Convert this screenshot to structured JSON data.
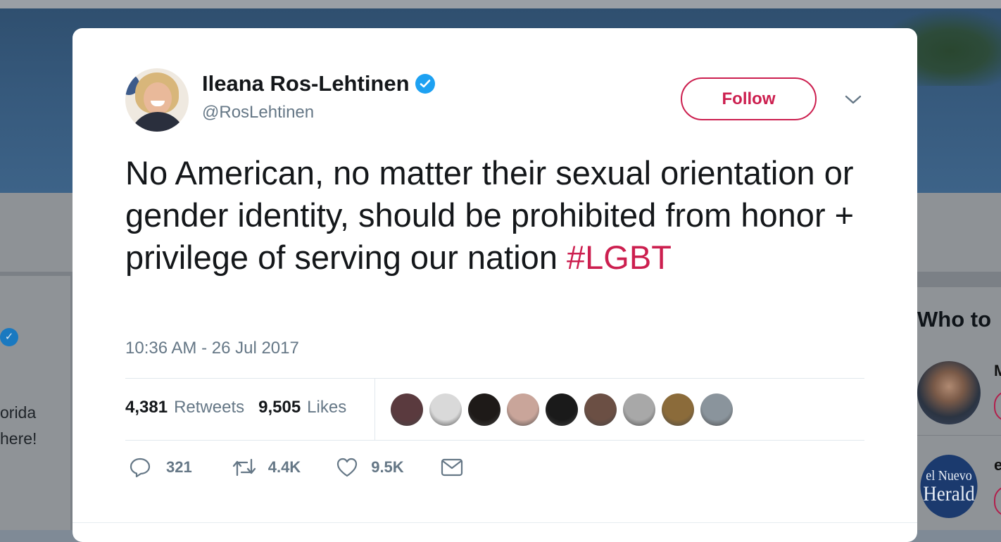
{
  "background": {
    "bio_lines": [
      "orida",
      "here!"
    ],
    "who_to_follow_title": "Who to",
    "suggestions": [
      {
        "name_fragment": "M",
        "avatar": "portrait-with-flag"
      },
      {
        "name_fragment": "e",
        "avatar_text": [
          "el Nuevo",
          "Herald"
        ]
      }
    ]
  },
  "tweet": {
    "author_name": "Ileana Ros-Lehtinen",
    "handle": "@RosLehtinen",
    "verified_icon": "verified-badge-icon",
    "follow_label": "Follow",
    "text_main": "No American, no matter their sexual orientation or gender identity, should be prohibited from honor + privilege of serving our nation ",
    "hashtag": "#LGBT",
    "timestamp": "10:36 AM - 26 Jul 2017",
    "stats": {
      "retweets_count": "4,381",
      "retweets_label": "Retweets",
      "likes_count": "9,505",
      "likes_label": "Likes"
    },
    "liker_avatars": [
      {
        "name": "liker-avatar-1",
        "color": "#5a3a3e"
      },
      {
        "name": "liker-avatar-2",
        "color": "#d9d9d9"
      },
      {
        "name": "liker-avatar-3",
        "color": "#1e1a18"
      },
      {
        "name": "liker-avatar-4",
        "color": "#c9a59a"
      },
      {
        "name": "liker-avatar-5",
        "color": "#1a1a1a"
      },
      {
        "name": "liker-avatar-6",
        "color": "#6b4f44"
      },
      {
        "name": "liker-avatar-7",
        "color": "#a8a8a8"
      },
      {
        "name": "liker-avatar-8",
        "color": "#8b6b3a"
      },
      {
        "name": "liker-avatar-9",
        "color": "#8a949c"
      }
    ],
    "actions": {
      "reply_count": "321",
      "retweet_count": "4.4K",
      "like_count": "9.5K"
    }
  },
  "colors": {
    "accent": "#cc1f4f",
    "verified": "#1da1f2",
    "secondary_text": "#657786"
  }
}
